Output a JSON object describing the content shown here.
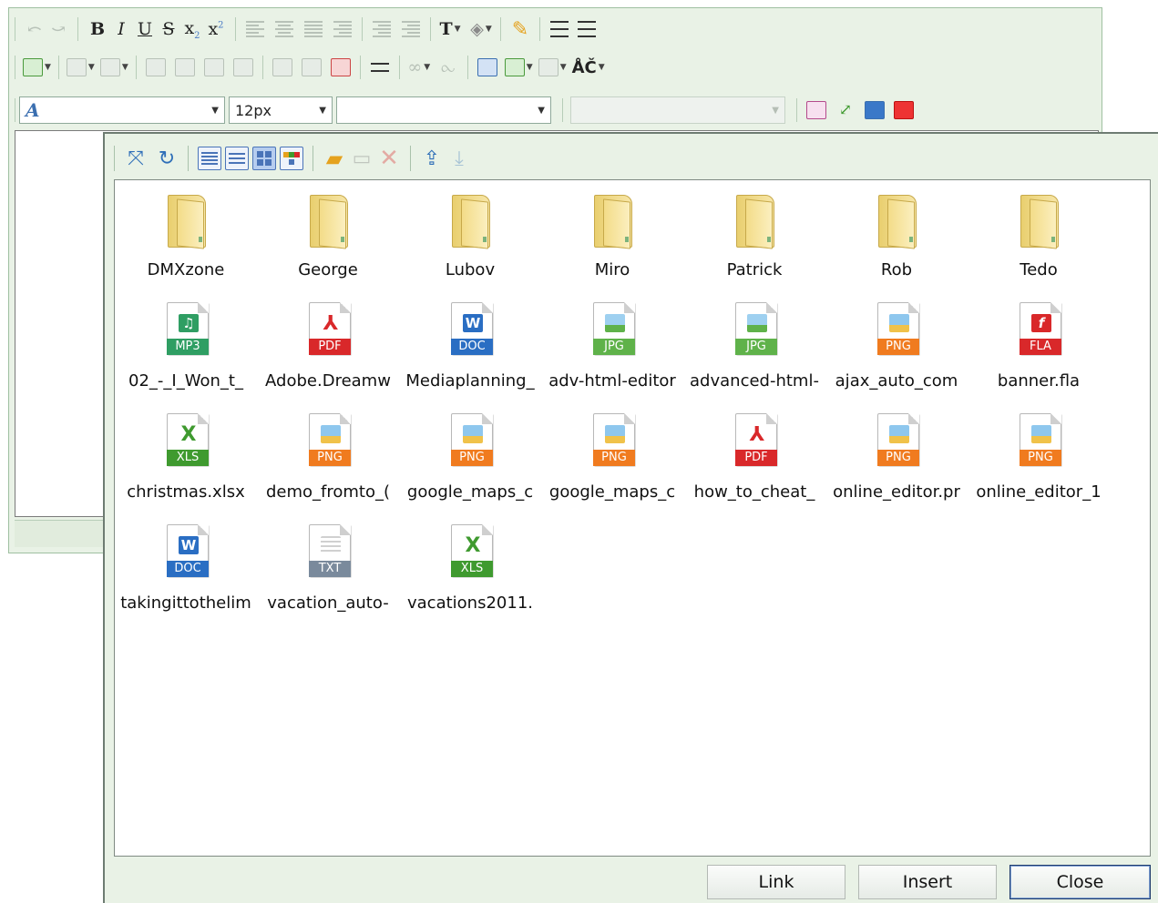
{
  "editor": {
    "row3": {
      "font_name": "",
      "font_size": "12px",
      "format": "",
      "style": ""
    },
    "special_chars_label": "ÅČ",
    "text_color_label": "T"
  },
  "dialog": {
    "active_view": "thumbnails",
    "folders": [
      {
        "name": "DMXzone"
      },
      {
        "name": "George"
      },
      {
        "name": "Lubov"
      },
      {
        "name": "Miro"
      },
      {
        "name": "Patrick"
      },
      {
        "name": "Rob"
      },
      {
        "name": "Tedo"
      }
    ],
    "files": [
      {
        "name": "02_-_I_Won_t_",
        "type": "MP3"
      },
      {
        "name": "Adobe.Dreamw",
        "type": "PDF"
      },
      {
        "name": "Mediaplanning_",
        "type": "DOC"
      },
      {
        "name": "adv-html-editor",
        "type": "JPG"
      },
      {
        "name": "advanced-html-",
        "type": "JPG"
      },
      {
        "name": "ajax_auto_com",
        "type": "PNG"
      },
      {
        "name": "banner.fla",
        "type": "FLA"
      },
      {
        "name": "christmas.xlsx",
        "type": "XLS"
      },
      {
        "name": "demo_fromto_(",
        "type": "PNG"
      },
      {
        "name": "google_maps_c",
        "type": "PNG"
      },
      {
        "name": "google_maps_c",
        "type": "PNG"
      },
      {
        "name": "how_to_cheat_",
        "type": "PDF"
      },
      {
        "name": "online_editor.pr",
        "type": "PNG"
      },
      {
        "name": "online_editor_1",
        "type": "PNG"
      },
      {
        "name": "takingittothelim",
        "type": "DOC"
      },
      {
        "name": "vacation_auto-",
        "type": "TXT"
      },
      {
        "name": "vacations2011.",
        "type": "XLS"
      }
    ],
    "buttons": {
      "link": "Link",
      "insert": "Insert",
      "close": "Close"
    }
  }
}
